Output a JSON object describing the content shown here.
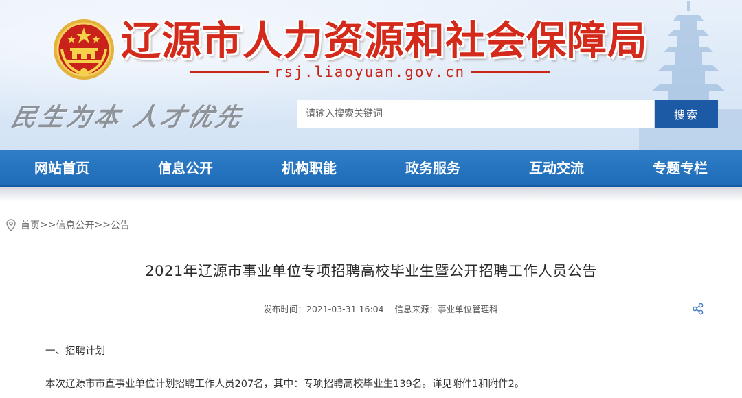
{
  "header": {
    "site_title": "辽源市人力资源和社会保障局",
    "domain_url": "rsj.liaoyuan.gov.cn",
    "slogan": "民生为本 人才优先",
    "emblem_icon": "national-emblem-icon",
    "search": {
      "placeholder": "请输入搜索关键词",
      "button_label": "搜索"
    }
  },
  "nav": {
    "items": [
      "网站首页",
      "信息公开",
      "机构职能",
      "政务服务",
      "互动交流",
      "专题专栏"
    ]
  },
  "breadcrumb": {
    "icon": "location-pin-icon",
    "items": [
      "首页",
      "信息公开",
      "公告"
    ],
    "separator": ">>"
  },
  "article": {
    "title": "2021年辽源市事业单位专项招聘高校毕业生暨公开招聘工作人员公告",
    "publish_time_label": "发布时间：",
    "publish_time": "2021-03-31 16:04",
    "source_label": "信息来源：",
    "source": "事业单位管理科",
    "share_icon": "share-icon",
    "section_heading": "一、招聘计划",
    "paragraph": "本次辽源市市直事业单位计划招聘工作人员207名，其中：专项招聘高校毕业生139名。详见附件1和附件2。"
  },
  "colors": {
    "title_red": "#d42a1b",
    "nav_blue": "#1f6cb8",
    "search_button_blue": "#1d5aa6",
    "header_bg": "#dbe8f7"
  }
}
